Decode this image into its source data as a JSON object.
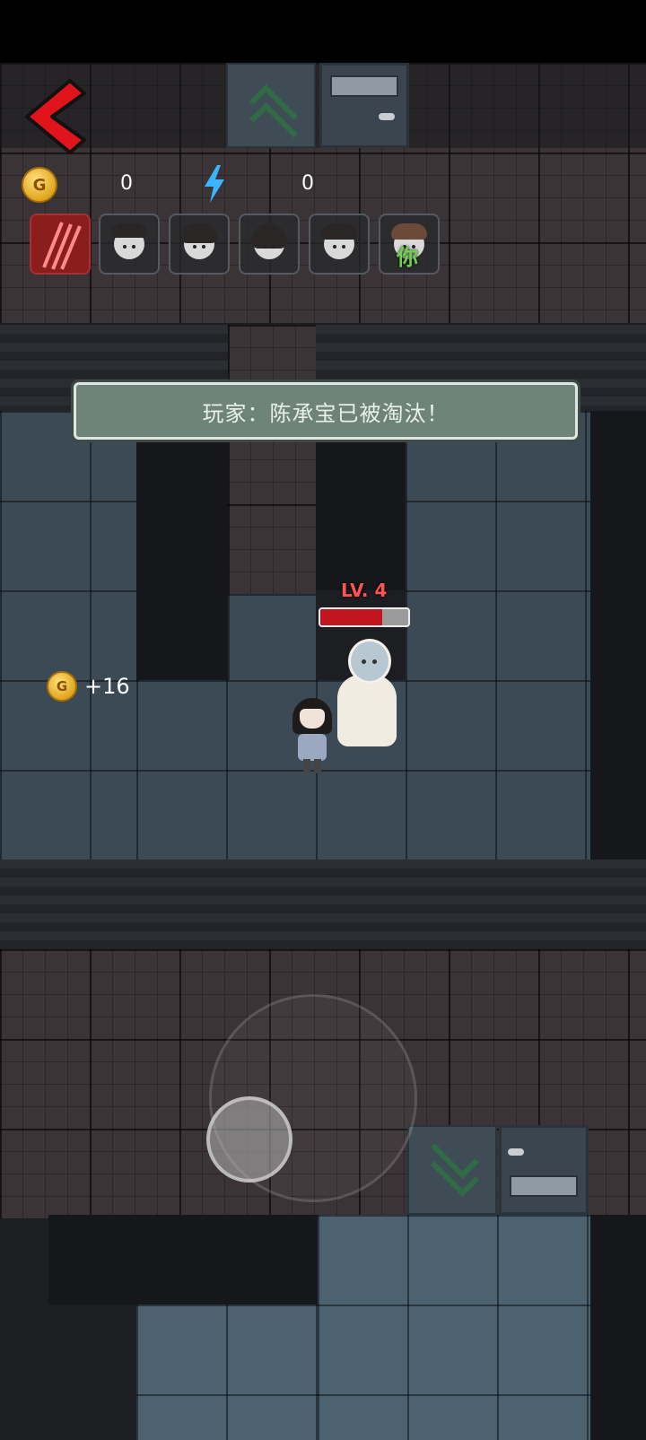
{
  "hud": {
    "back": "back-arrow",
    "coins": "0",
    "energy": "0",
    "coin_symbol": "G"
  },
  "players": [
    {
      "name": "claw-skill-icon"
    },
    {
      "name": "player-avatar-1"
    },
    {
      "name": "player-avatar-2"
    },
    {
      "name": "player-avatar-3"
    },
    {
      "name": "player-avatar-4"
    },
    {
      "name": "player-avatar-self",
      "label": "你"
    }
  ],
  "banner": {
    "text": "玩家：陈承宝已被淘汰！"
  },
  "enemy": {
    "level_label": "LV. 4",
    "health_fraction": 0.7
  },
  "reward": {
    "text": "+16",
    "coin_symbol": "G"
  },
  "colors": {
    "accent": "#c1161d",
    "you_label": "#6ed34a",
    "banner": "#6e847a"
  }
}
